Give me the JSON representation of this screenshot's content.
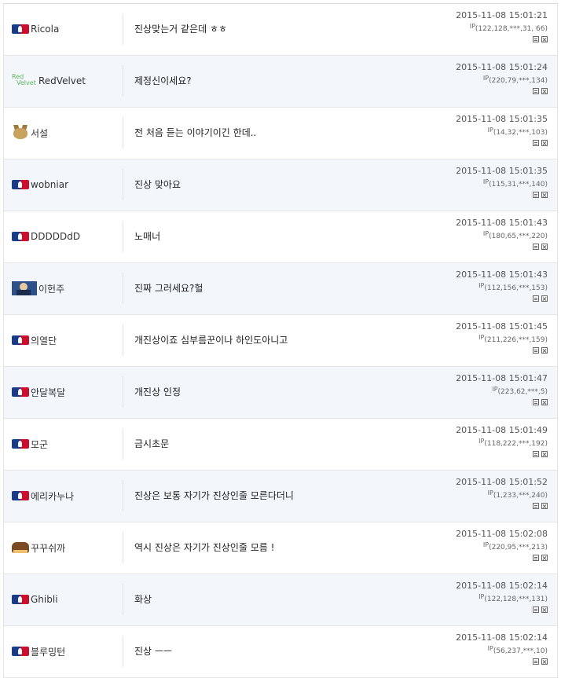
{
  "colors": {
    "alt_row_bg": "#f3f7fb",
    "border": "#e4e4e4",
    "mlb_blue": "#1a3a8a",
    "mlb_red": "#c8102e"
  },
  "comments": [
    {
      "icon": "mlb-logo-icon",
      "user": "Ricola",
      "message": "진상맞는거 같은데 ㅎㅎ",
      "time": "2015-11-08 15:01:21",
      "ip_label": "IP",
      "ip": "(122,128,***,31, 66)",
      "alt": false
    },
    {
      "icon": "red-velvet-logo-icon",
      "icon_text_1": "Red",
      "icon_text_2": "Velvet",
      "user": "RedVelvet",
      "message": "제정신이세요?",
      "time": "2015-11-08 15:01:24",
      "ip_label": "IP",
      "ip": "(220,79,***,134)",
      "alt": true
    },
    {
      "icon": "cat-avatar-icon",
      "user": "서설",
      "message": "전 처음 듣는 이야기이긴 한데..",
      "time": "2015-11-08 15:01:35",
      "ip_label": "IP",
      "ip": "(14,32,***,103)",
      "alt": false
    },
    {
      "icon": "mlb-logo-icon",
      "user": "wobniar",
      "message": "진상 맞아요",
      "time": "2015-11-08 15:01:35",
      "ip_label": "IP",
      "ip": "(115,31,***,140)",
      "alt": true
    },
    {
      "icon": "mlb-logo-icon",
      "user": "DDDDDdD",
      "message": "노매너",
      "time": "2015-11-08 15:01:43",
      "ip_label": "IP",
      "ip": "(180,65,***,220)",
      "alt": false
    },
    {
      "icon": "player-photo-icon",
      "user": "이헌주",
      "message": "진짜 그러세요?헐",
      "time": "2015-11-08 15:01:43",
      "ip_label": "IP",
      "ip": "(112,156,***,153)",
      "alt": true
    },
    {
      "icon": "mlb-logo-icon",
      "user": "의열단",
      "message": "개진상이죠 심부름꾼이나 하인도아니고",
      "time": "2015-11-08 15:01:45",
      "ip_label": "IP",
      "ip": "(211,226,***,159)",
      "alt": false
    },
    {
      "icon": "mlb-logo-icon",
      "user": "안달복달",
      "message": "개진상 인정",
      "time": "2015-11-08 15:01:47",
      "ip_label": "IP",
      "ip": "(223,62,***,5)",
      "alt": true
    },
    {
      "icon": "mlb-logo-icon",
      "user": "모군",
      "message": "금시초문",
      "time": "2015-11-08 15:01:49",
      "ip_label": "IP",
      "ip": "(118,222,***,192)",
      "alt": false
    },
    {
      "icon": "mlb-logo-icon",
      "user": "에리카누나",
      "message": "진상은 보통 자기가 진상인줄 모른다더니",
      "time": "2015-11-08 15:01:52",
      "ip_label": "IP",
      "ip": "(1,233,***,240)",
      "alt": true
    },
    {
      "icon": "chocolate-pie-icon",
      "user": "꾸꾸쉬까",
      "message": "역시 진상은 자기가 진상인줄 모름 !",
      "time": "2015-11-08 15:02:08",
      "ip_label": "IP",
      "ip": "(220,95,***,213)",
      "alt": false
    },
    {
      "icon": "mlb-logo-icon",
      "user": "Ghibli",
      "message": "화상",
      "time": "2015-11-08 15:02:14",
      "ip_label": "IP",
      "ip": "(122,128,***,131)",
      "alt": true
    },
    {
      "icon": "mlb-logo-icon",
      "user": "블루밍턴",
      "message": "진상 ㅡㅡ",
      "time": "2015-11-08 15:02:14",
      "ip_label": "IP",
      "ip": "(56,237,***,10)",
      "alt": false
    }
  ]
}
